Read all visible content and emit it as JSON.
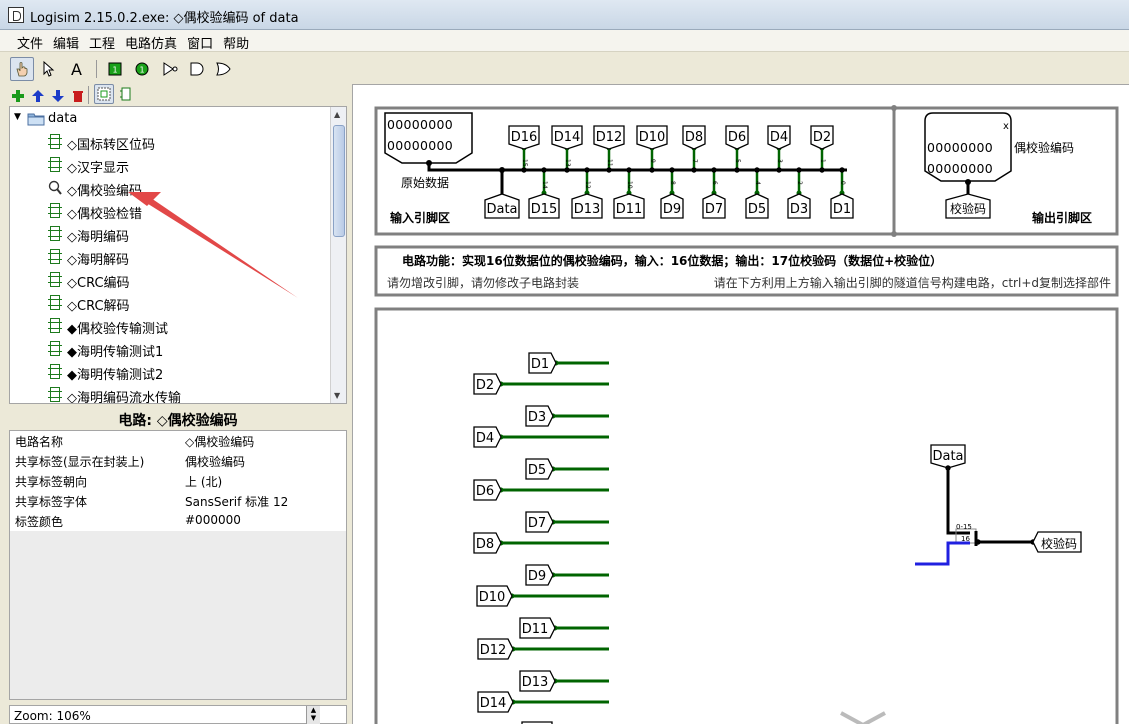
{
  "window": {
    "title": "Logisim 2.15.0.2.exe: ◇偶校验编码 of data"
  },
  "menu": [
    "文件",
    "编辑",
    "工程",
    "电路仿真",
    "窗口",
    "帮助"
  ],
  "toolbar": {
    "tools": [
      "hand-poke-icon",
      "select-arrow-icon",
      "text-tool-icon",
      "input-pin-icon",
      "output-pin-icon",
      "not-gate-icon",
      "and-gate-icon",
      "or-gate-icon"
    ],
    "project_tools": [
      "add-circuit-icon",
      "move-up-icon",
      "move-down-icon",
      "delete-circuit-icon",
      "layout-view-icon",
      "appearance-view-icon"
    ]
  },
  "tree": {
    "root": "data",
    "items": [
      {
        "label": "◇国标转区位码",
        "icon": "chip-icon"
      },
      {
        "label": "◇汉字显示",
        "icon": "chip-icon"
      },
      {
        "label": "◇偶校验编码",
        "icon": "magnifier-icon"
      },
      {
        "label": "◇偶校验检错",
        "icon": "chip-icon"
      },
      {
        "label": "◇海明编码",
        "icon": "chip-icon"
      },
      {
        "label": "◇海明解码",
        "icon": "chip-icon"
      },
      {
        "label": "◇CRC编码",
        "icon": "chip-icon"
      },
      {
        "label": "◇CRC解码",
        "icon": "chip-icon"
      },
      {
        "label": "◆偶校验传输测试",
        "icon": "chip-icon"
      },
      {
        "label": "◆海明传输测试1",
        "icon": "chip-icon"
      },
      {
        "label": "◆海明传输测试2",
        "icon": "chip-icon"
      },
      {
        "label": "◇海明编码流水传输",
        "icon": "chip-icon"
      }
    ]
  },
  "properties": {
    "title": "电路: ◇偶校验编码",
    "rows": [
      {
        "key": "电路名称",
        "value": "◇偶校验编码"
      },
      {
        "key": "共享标签(显示在封装上)",
        "value": "偶校验编码"
      },
      {
        "key": "共享标签朝向",
        "value": "上 (北)"
      },
      {
        "key": "共享标签字体",
        "value": "SansSerif 标准 12"
      },
      {
        "key": "标签颜色",
        "value": "#000000"
      }
    ]
  },
  "zoom": "Zoom: 106%",
  "canvas": {
    "input_section_label": "输入引脚区",
    "output_section_label": "输出引脚区",
    "raw_data_label": "原始数据",
    "input_pin_bits": "00000000",
    "top_tunnels": [
      "D16",
      "D14",
      "D12",
      "D10",
      "D8",
      "D6",
      "D4",
      "D2"
    ],
    "bottom_tunnels": [
      "Data",
      "D15",
      "D13",
      "D11",
      "D9",
      "D7",
      "D5",
      "D3",
      "D1"
    ],
    "top_bit_indices": [
      "15",
      "13",
      "11",
      "9",
      "7",
      "5",
      "3",
      "1"
    ],
    "bottom_bit_indices": [
      "14",
      "12",
      "10",
      "8",
      "6",
      "4",
      "2",
      "0"
    ],
    "output_pin_bits": "00000000",
    "output_pin_marker": "x",
    "output_pin_label": "偶校验编码",
    "output_tunnel": "校验码",
    "function_text": "电路功能：实现16位数据位的偶校验编码，输入：16位数据；输出：17位校验码（数据位+校验位）",
    "note_left": "请勿增改引脚，请勿修改子电路封装",
    "note_right": "请在下方利用上方输入输出引脚的隧道信号构建电路，ctrl+d复制选择部件",
    "work_left_tunnels": [
      "D1",
      "D2",
      "D3",
      "D4",
      "D5",
      "D6",
      "D7",
      "D8",
      "D9",
      "D10",
      "D11",
      "D12",
      "D13",
      "D14"
    ],
    "work_data_tunnel": "Data",
    "splitter_range": "0-15",
    "splitter_bit": "16",
    "work_output_tunnel": "校验码"
  },
  "colors": {
    "wire_active": "#006400",
    "wire_bus": "#000000",
    "wire_blue": "#2020e0",
    "section_border": "#808080"
  }
}
